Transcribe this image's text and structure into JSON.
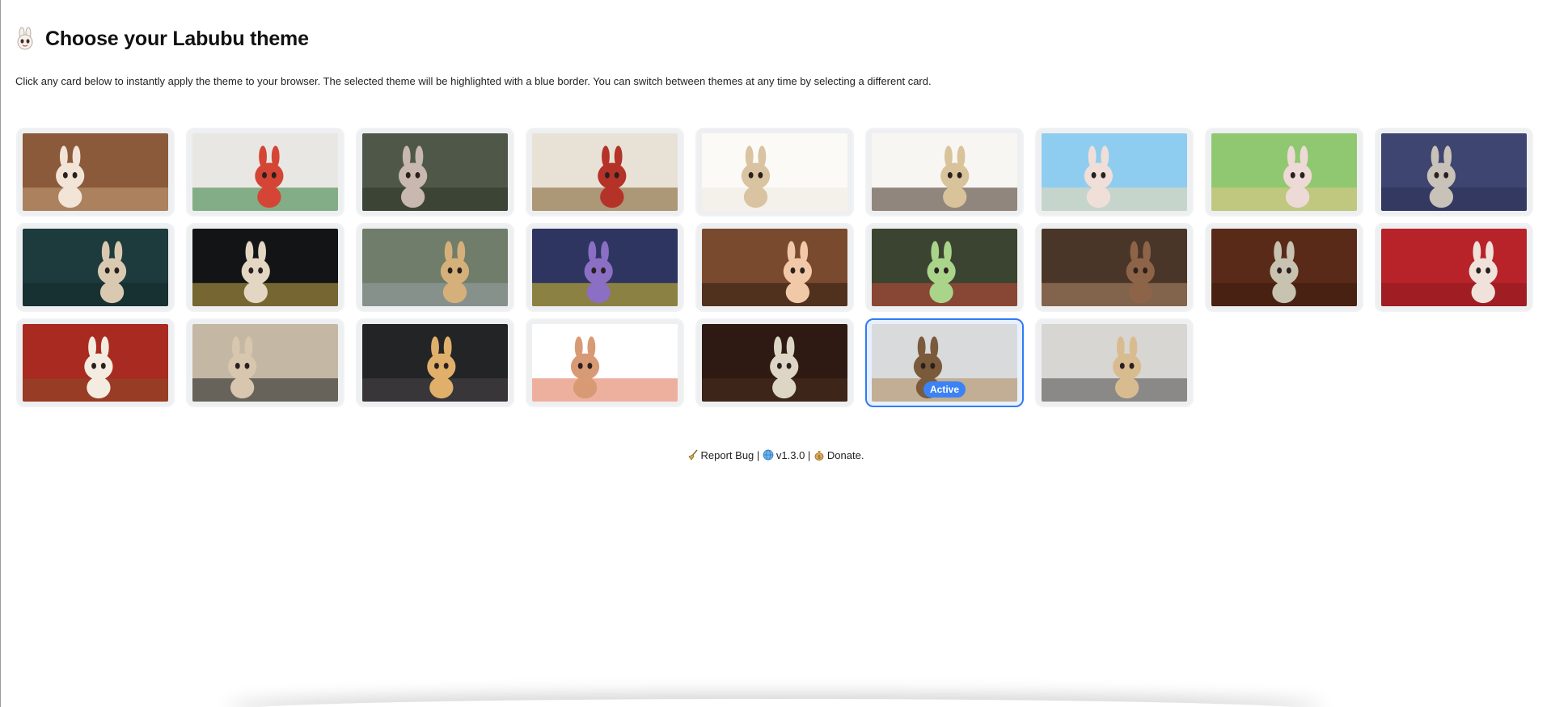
{
  "header": {
    "icon": "labubu-icon",
    "title": "Choose your Labubu theme"
  },
  "description": "Click any card below to instantly apply the theme to your browser. The selected theme will be highlighted with a blue border. You can switch between themes at any time by selecting a different card.",
  "themes": [
    {
      "bg": "#8a5a3a",
      "fg": "#f3e4d8",
      "accent": "#c9a27a",
      "active": false
    },
    {
      "bg": "#e9e7e3",
      "fg": "#d44535",
      "accent": "#2f7d3b",
      "active": false
    },
    {
      "bg": "#4f5848",
      "fg": "#c8b8b0",
      "accent": "#2e3528",
      "active": false
    },
    {
      "bg": "#e8e2d6",
      "fg": "#b43228",
      "accent": "#7a5a2a",
      "active": false
    },
    {
      "bg": "#fbfaf7",
      "fg": "#d9c3a0",
      "accent": "#eeeae2",
      "active": false
    },
    {
      "bg": "#f8f6f2",
      "fg": "#d9c39a",
      "accent": "#3a2a1e",
      "active": false
    },
    {
      "bg": "#8fcdf0",
      "fg": "#f0dfd8",
      "accent": "#f3dcae",
      "active": false
    },
    {
      "bg": "#8fc870",
      "fg": "#eddad6",
      "accent": "#e8c88a",
      "active": false
    },
    {
      "bg": "#3e4570",
      "fg": "#c9c2b8",
      "accent": "#2a2f55",
      "active": false
    },
    {
      "bg": "#1d3a3c",
      "fg": "#d9c9b0",
      "accent": "#12292b",
      "active": false
    },
    {
      "bg": "#121416",
      "fg": "#e3d6c2",
      "accent": "#c9a948",
      "active": false
    },
    {
      "bg": "#6f7d6a",
      "fg": "#d6b07a",
      "accent": "#9aa3a8",
      "active": false
    },
    {
      "bg": "#2d3560",
      "fg": "#8b6fc4",
      "accent": "#d8c02c",
      "active": false
    },
    {
      "bg": "#7a4a2e",
      "fg": "#f2c9a8",
      "accent": "#2e1d12",
      "active": false
    },
    {
      "bg": "#3a4430",
      "fg": "#a9d48a",
      "accent": "#c84a3a",
      "active": false
    },
    {
      "bg": "#4a3628",
      "fg": "#8e6448",
      "accent": "#b08868",
      "active": false
    },
    {
      "bg": "#5a2a18",
      "fg": "#c8c2b0",
      "accent": "#3a1a0e",
      "active": false
    },
    {
      "bg": "#b8232a",
      "fg": "#f0e2da",
      "accent": "#8a1a1e",
      "active": false
    },
    {
      "bg": "#a82a20",
      "fg": "#f4ece0",
      "accent": "#8a4a2a",
      "active": false
    },
    {
      "bg": "#c4b8a4",
      "fg": "#d8c6ae",
      "accent": "#1e1e1e",
      "active": false
    },
    {
      "bg": "#222426",
      "fg": "#e0b06a",
      "accent": "#4a4648",
      "active": false
    },
    {
      "bg": "#ffffff",
      "fg": "#d89a74",
      "accent": "#e0704e",
      "active": false
    },
    {
      "bg": "#2e1a12",
      "fg": "#ddd6c6",
      "accent": "#4a3020",
      "active": false
    },
    {
      "bg": "#d8dadc",
      "fg": "#7a5a3a",
      "accent": "#b08a5a",
      "active": true
    },
    {
      "bg": "#d8d6d2",
      "fg": "#d8bc90",
      "accent": "#4a4a4a",
      "active": false
    }
  ],
  "active_badge": "Active",
  "footer": {
    "bug_icon": "broom-icon",
    "report_bug": "Report Bug",
    "sep1": " | ",
    "globe_icon": "globe-icon",
    "version": "v1.3.0",
    "sep2": " | ",
    "money_icon": "money-bag-icon",
    "donate": "Donate."
  }
}
